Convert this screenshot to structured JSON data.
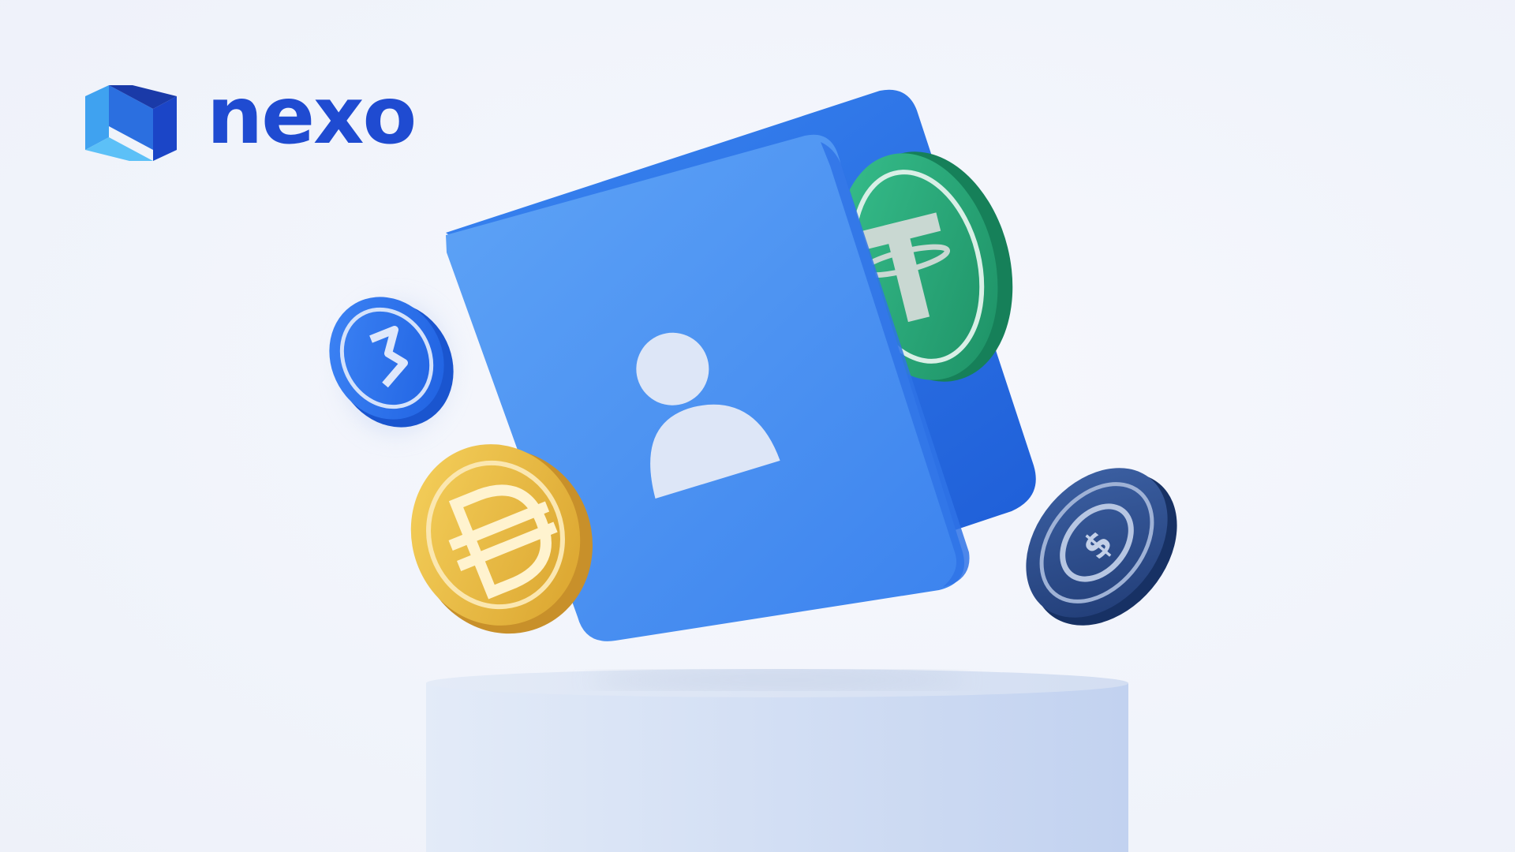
{
  "brand": {
    "name": "nexo",
    "logo_icon": "nexo-logo-icon",
    "color": "#1f4bd1"
  },
  "illustration": {
    "wallet_icon": "wallet-icon",
    "user_icon": "user-icon",
    "coins": [
      {
        "icon": "usdt-coin-icon",
        "color": "#27a67a"
      },
      {
        "icon": "usdc-coin-icon",
        "color": "#2563eb"
      },
      {
        "icon": "dai-coin-icon",
        "color": "#e9b53a"
      },
      {
        "icon": "usd-coin-icon",
        "color": "#2c4a86"
      }
    ],
    "pedestal_icon": "pedestal-icon"
  }
}
